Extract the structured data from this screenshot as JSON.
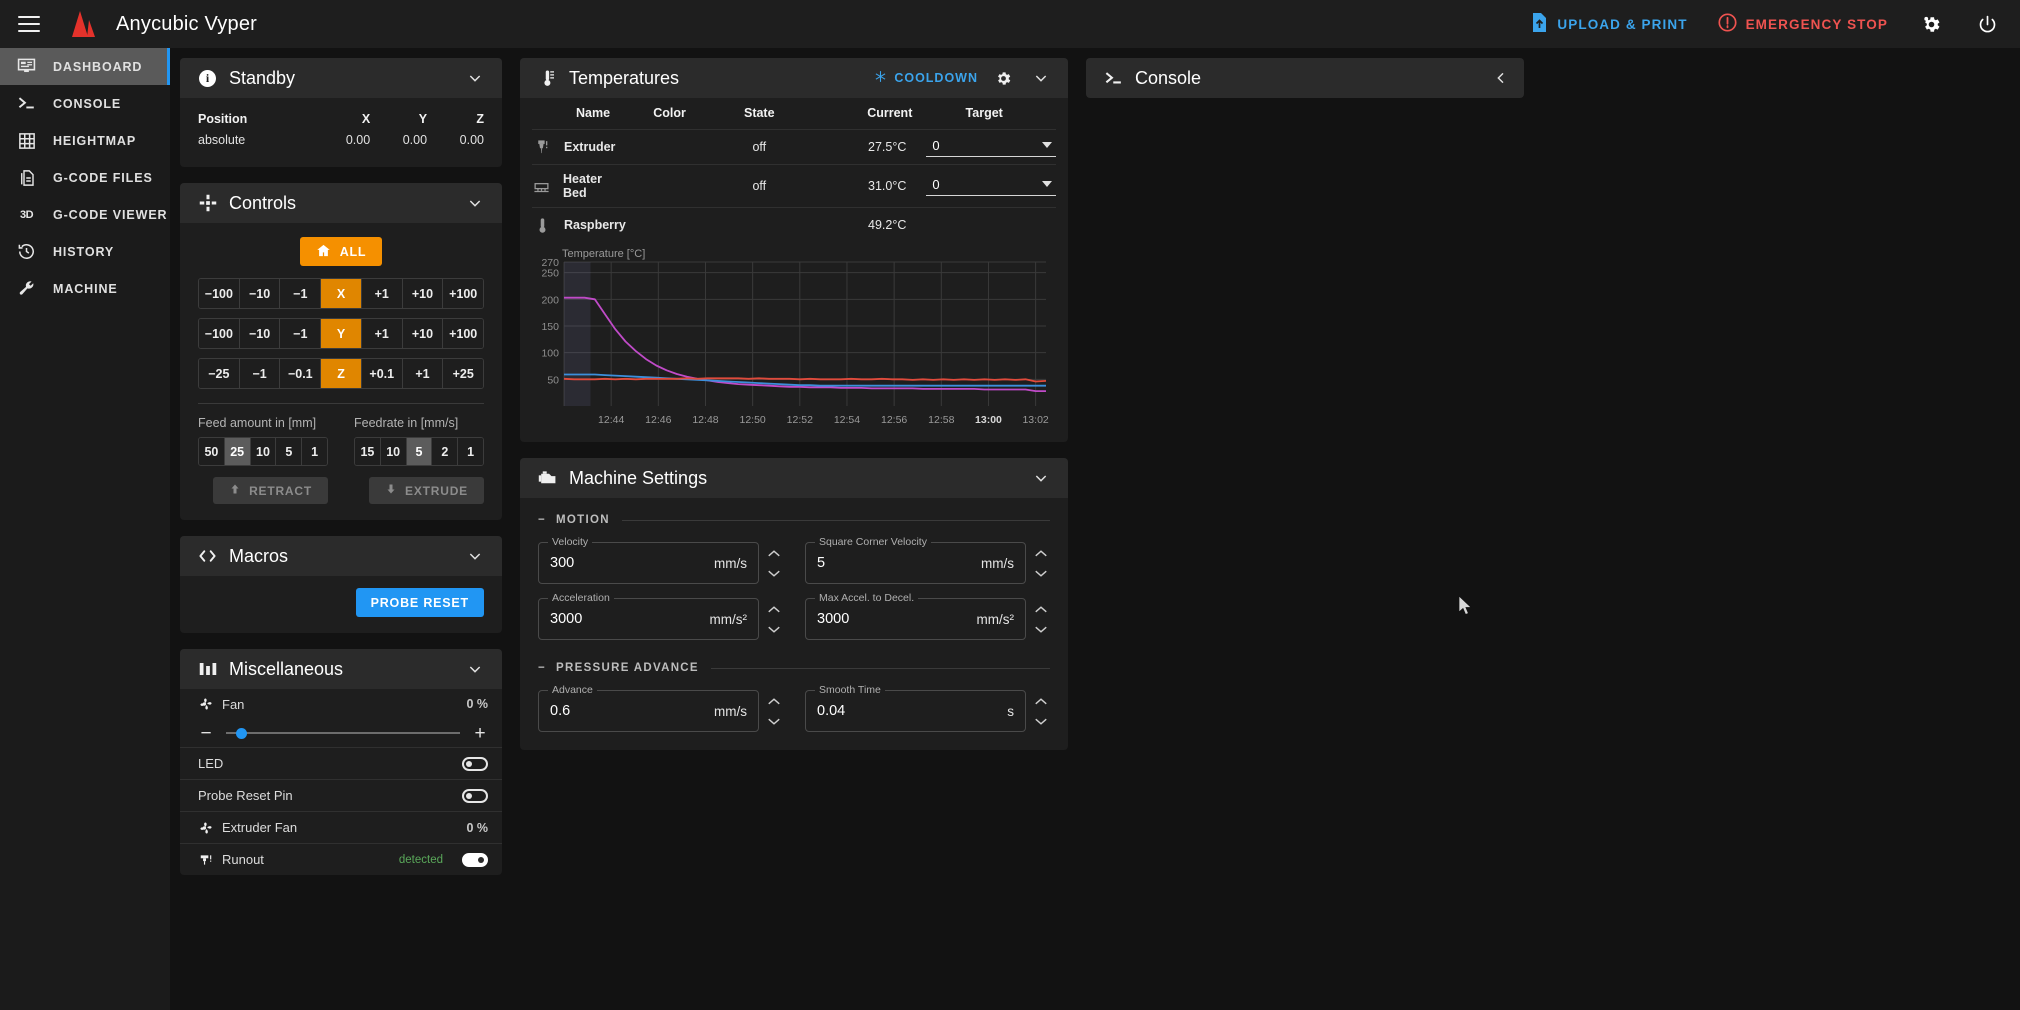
{
  "appbar": {
    "menu_icon": "hamburger-icon",
    "brand": "Anycubic Vyper",
    "upload_label": "UPLOAD & PRINT",
    "upload_icon": "file-upload-icon",
    "estop_label": "EMERGENCY STOP",
    "estop_icon": "alert-circle-icon",
    "settings_icon": "gear-icon",
    "power_icon": "power-icon",
    "accent_upload": "#3ba4ec",
    "accent_estop": "#ef5350"
  },
  "sidebar": {
    "items": [
      {
        "label": "DASHBOARD",
        "icon": "dashboard-icon",
        "active": true
      },
      {
        "label": "CONSOLE",
        "icon": "console-icon",
        "active": false
      },
      {
        "label": "HEIGHTMAP",
        "icon": "grid-icon",
        "active": false
      },
      {
        "label": "G-CODE FILES",
        "icon": "file-icon",
        "active": false
      },
      {
        "label": "G-CODE VIEWER",
        "icon": "3d-icon",
        "active": false
      },
      {
        "label": "HISTORY",
        "icon": "history-icon",
        "active": false
      },
      {
        "label": "MACHINE",
        "icon": "wrench-icon",
        "active": false
      }
    ]
  },
  "status": {
    "title": "Standby",
    "icon": "info-icon",
    "headers": [
      "Position",
      "X",
      "Y",
      "Z"
    ],
    "row": [
      "absolute",
      "0.00",
      "0.00",
      "0.00"
    ]
  },
  "controls": {
    "title": "Controls",
    "icon": "dpad-icon",
    "home_label": "ALL",
    "home_icon": "home-icon",
    "rows": [
      {
        "axis": "X",
        "left": [
          "−100",
          "−10",
          "−1"
        ],
        "right": [
          "+1",
          "+10",
          "+100"
        ]
      },
      {
        "axis": "Y",
        "left": [
          "−100",
          "−10",
          "−1"
        ],
        "right": [
          "+1",
          "+10",
          "+100"
        ]
      },
      {
        "axis": "Z",
        "left": [
          "−25",
          "−1",
          "−0.1"
        ],
        "right": [
          "+0.1",
          "+1",
          "+25"
        ]
      }
    ],
    "feed_amount_label": "Feed amount in [mm]",
    "feed_amount_options": [
      "50",
      "25",
      "10",
      "5",
      "1"
    ],
    "feed_amount_selected": "25",
    "feedrate_label": "Feedrate in [mm/s]",
    "feedrate_options": [
      "15",
      "10",
      "5",
      "2",
      "1"
    ],
    "feedrate_selected": "5",
    "retract_label": "RETRACT",
    "retract_icon": "arrow-up-icon",
    "extrude_label": "EXTRUDE",
    "extrude_icon": "arrow-down-icon"
  },
  "macros": {
    "title": "Macros",
    "icon": "code-icon",
    "buttons": [
      {
        "label": "PROBE RESET",
        "color": "#2196f3"
      }
    ]
  },
  "miscellaneous": {
    "title": "Miscellaneous",
    "icon": "sliders-icon",
    "rows": [
      {
        "name": "Fan",
        "icon": "fan-icon",
        "value": "0 %",
        "type": "slider",
        "slider_pos": 5
      },
      {
        "name": "LED",
        "icon": "",
        "value": "",
        "type": "toggle",
        "on": false
      },
      {
        "name": "Probe Reset Pin",
        "icon": "",
        "value": "",
        "type": "toggle",
        "on": false
      },
      {
        "name": "Extruder Fan",
        "icon": "fan-icon",
        "value": "0 %",
        "type": "value"
      },
      {
        "name": "Runout",
        "icon": "filament-icon",
        "value": "detected",
        "type": "toggle",
        "on": true,
        "value_color": "#5aa85a"
      }
    ]
  },
  "temperatures": {
    "title": "Temperatures",
    "icon": "thermometer-icon",
    "cooldown_label": "COOLDOWN",
    "cooldown_icon": "snowflake-icon",
    "settings_icon": "gear-icon",
    "headers": [
      "Name",
      "Color",
      "State",
      "Current",
      "Target"
    ],
    "rows": [
      {
        "name": "Extruder",
        "icon": "nozzle-icon",
        "color": "#a03cb4",
        "state": "off",
        "current": "27.5°C",
        "target": "0",
        "has_target": true
      },
      {
        "name": "Heater Bed",
        "icon": "bed-icon",
        "color": "#2196f3",
        "state": "off",
        "current": "31.0°C",
        "target": "0",
        "has_target": true
      },
      {
        "name": "Raspberry",
        "icon": "thermometer-icon",
        "color": "#e04b3c",
        "state": "",
        "current": "49.2°C",
        "target": "",
        "has_target": false
      }
    ]
  },
  "chart_data": {
    "type": "line",
    "title": "Temperature [°C]",
    "xlabel": "",
    "ylabel": "Temperature [°C]",
    "ylim": [
      0,
      270
    ],
    "yticks": [
      50,
      100,
      150,
      200,
      250,
      270
    ],
    "x": [
      "12:44",
      "12:46",
      "12:48",
      "12:50",
      "12:52",
      "12:54",
      "12:56",
      "12:58",
      "13:00",
      "13:02"
    ],
    "xticks": [
      "12:44",
      "12:46",
      "12:48",
      "12:50",
      "12:52",
      "12:54",
      "12:56",
      "12:58",
      "13:00",
      "13:02"
    ],
    "grid": true,
    "legend": "none",
    "series": [
      {
        "name": "Extruder",
        "color": "#c04bc8",
        "values": [
          203,
          203,
          203,
          200,
          172,
          144,
          121,
          103,
          88,
          76,
          67,
          60,
          55,
          51,
          48,
          45,
          43,
          41,
          40,
          39,
          38,
          37,
          36,
          36,
          35,
          35,
          35,
          34,
          34,
          34,
          33,
          33,
          33,
          33,
          33,
          32,
          32,
          32,
          32,
          32,
          32,
          31,
          31,
          31,
          31,
          31,
          28,
          28
        ]
      },
      {
        "name": "Heater Bed",
        "color": "#3c8fdc",
        "values": [
          59,
          59,
          59,
          59,
          58,
          57,
          56,
          55,
          54,
          53,
          52,
          51,
          50,
          49,
          48,
          47,
          46,
          45,
          44,
          43,
          42,
          41,
          40,
          39,
          39,
          38,
          38,
          38,
          38,
          38,
          38,
          38,
          38,
          38,
          38,
          38,
          38,
          38,
          38,
          38,
          38,
          38,
          38,
          38,
          38,
          38,
          38,
          38
        ]
      },
      {
        "name": "Raspberry",
        "color": "#e04b3c",
        "values": [
          51,
          50,
          50,
          50,
          51,
          50,
          51,
          50,
          51,
          51,
          51,
          51,
          52,
          51,
          52,
          52,
          52,
          52,
          51,
          52,
          51,
          51,
          51,
          50,
          51,
          50,
          50,
          50,
          51,
          50,
          50,
          51,
          50,
          50,
          49,
          50,
          49,
          50,
          49,
          50,
          49,
          50,
          49,
          50,
          49,
          50,
          46,
          47
        ]
      }
    ]
  },
  "machine_settings": {
    "title": "Machine Settings",
    "icon": "engine-icon",
    "sections": [
      {
        "label": "MOTION",
        "fields": [
          {
            "label": "Velocity",
            "value": "300",
            "unit": "mm/s"
          },
          {
            "label": "Square Corner Velocity",
            "value": "5",
            "unit": "mm/s"
          },
          {
            "label": "Acceleration",
            "value": "3000",
            "unit": "mm/s²"
          },
          {
            "label": "Max Accel. to Decel.",
            "value": "3000",
            "unit": "mm/s²"
          }
        ]
      },
      {
        "label": "PRESSURE ADVANCE",
        "fields": [
          {
            "label": "Advance",
            "value": "0.6",
            "unit": "mm/s"
          },
          {
            "label": "Smooth Time",
            "value": "0.04",
            "unit": "s"
          }
        ]
      }
    ]
  },
  "console": {
    "title": "Console",
    "icon": "console-icon",
    "collapse_icon": "chevron-left-icon"
  }
}
